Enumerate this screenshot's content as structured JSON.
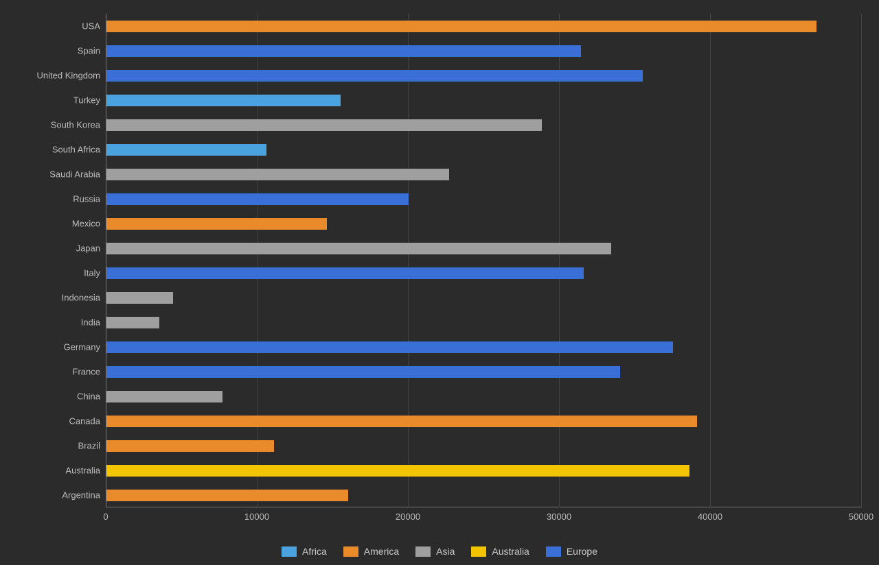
{
  "chart_data": {
    "type": "bar",
    "orientation": "horizontal",
    "xlim": [
      0,
      50000
    ],
    "x_ticks": [
      0,
      10000,
      20000,
      30000,
      40000,
      50000
    ],
    "categories": [
      "USA",
      "Spain",
      "United Kingdom",
      "Turkey",
      "South Korea",
      "South Africa",
      "Saudi Arabia",
      "Russia",
      "Mexico",
      "Japan",
      "Italy",
      "Indonesia",
      "India",
      "Germany",
      "France",
      "China",
      "Canada",
      "Brazil",
      "Australia",
      "Argentina"
    ],
    "series_for_category": [
      "America",
      "Europe",
      "Europe",
      "Africa",
      "Asia",
      "Africa",
      "Asia",
      "Europe",
      "America",
      "Asia",
      "Europe",
      "Asia",
      "Asia",
      "Europe",
      "Europe",
      "Asia",
      "America",
      "America",
      "Australia",
      "America"
    ],
    "values": [
      47000,
      31400,
      35500,
      15500,
      28800,
      10600,
      22700,
      20000,
      14600,
      33400,
      31600,
      4400,
      3500,
      37500,
      34000,
      7700,
      39100,
      11100,
      38600,
      16000
    ],
    "legend": [
      {
        "name": "Africa",
        "color": "#4aa3df"
      },
      {
        "name": "America",
        "color": "#e98b2a"
      },
      {
        "name": "Asia",
        "color": "#9f9f9f"
      },
      {
        "name": "Australia",
        "color": "#f2c500"
      },
      {
        "name": "Europe",
        "color": "#3a6fd8"
      }
    ]
  }
}
